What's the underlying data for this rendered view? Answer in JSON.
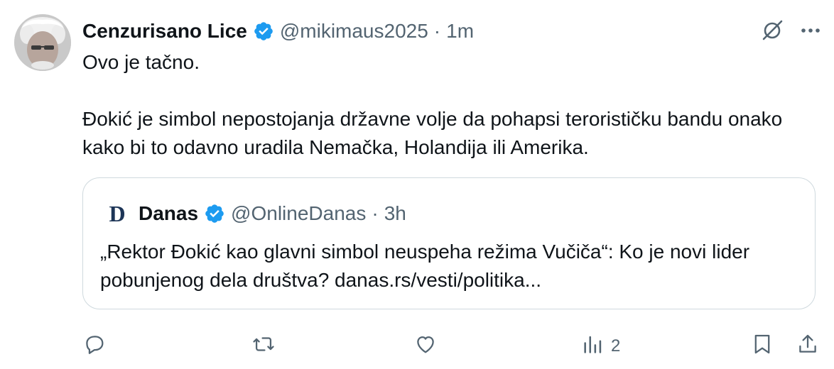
{
  "author": {
    "name": "Cenzurisano Lice",
    "handle": "@mikimaus2025",
    "separator": "·",
    "time": "1m",
    "avatar_icon": "avatar-photo"
  },
  "tweet": {
    "line1": "Ovo je tačno.",
    "line2": "Đokić je simbol nepostojanja državne volje da pohapsi terorističku bandu onako kako bi to odavno uradila Nemačka, Holandija ili Amerika."
  },
  "quote": {
    "logo_letter": "D",
    "name": "Danas",
    "handle": "@OnlineDanas",
    "separator": "·",
    "time": "3h",
    "text": "„Rektor Đokić kao glavni simbol neuspeha režima Vučiča“: Ko je novi lider pobunjenog dela društva? danas.rs/vesti/politika..."
  },
  "actions": {
    "views_count": "2"
  },
  "icons": {
    "verified": "verified-badge-icon",
    "grok": "grok-icon",
    "more": "more-icon",
    "reply": "reply-icon",
    "retweet": "retweet-icon",
    "like": "like-icon",
    "views": "views-icon",
    "bookmark": "bookmark-icon",
    "share": "share-icon"
  },
  "colors": {
    "verified_blue": "#1d9bf0",
    "muted_text": "#536471",
    "border": "#cfd9de",
    "text": "#0f1419"
  }
}
